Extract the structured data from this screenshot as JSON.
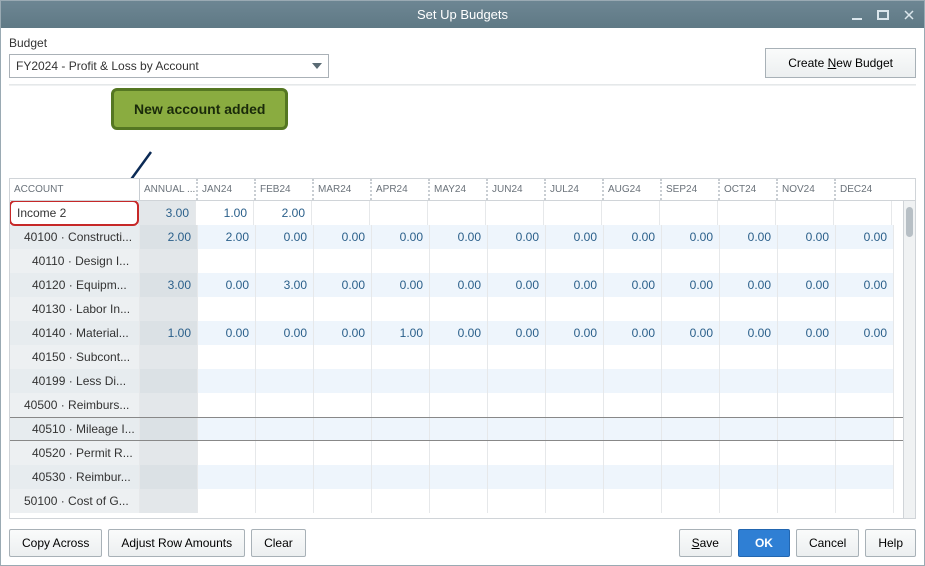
{
  "window": {
    "title": "Set Up Budgets"
  },
  "header": {
    "budget_label": "Budget",
    "dropdown_value": "FY2024 - Profit & Loss by Account",
    "create_button": "Create New Budget"
  },
  "annotation": {
    "label": "New account added"
  },
  "columns": {
    "account": "ACCOUNT",
    "annual": "ANNUAL ...",
    "months": [
      "JAN24",
      "FEB24",
      "MAR24",
      "APR24",
      "MAY24",
      "JUN24",
      "JUL24",
      "AUG24",
      "SEP24",
      "OCT24",
      "NOV24",
      "DEC24"
    ]
  },
  "rows": [
    {
      "account": "Income 2",
      "annual": "3.00",
      "months": [
        "1.00",
        "2.00",
        "",
        "",
        "",
        "",
        "",
        "",
        "",
        "",
        "",
        ""
      ],
      "hl": true
    },
    {
      "account": "40100 · Constructi...",
      "annual": "2.00",
      "months": [
        "2.00",
        "0.00",
        "0.00",
        "0.00",
        "0.00",
        "0.00",
        "0.00",
        "0.00",
        "0.00",
        "0.00",
        "0.00",
        "0.00"
      ],
      "indent": 1
    },
    {
      "account": "40110 · Design I...",
      "annual": "",
      "months": [
        "",
        "",
        "",
        "",
        "",
        "",
        "",
        "",
        "",
        "",
        "",
        ""
      ],
      "indent": 2
    },
    {
      "account": "40120 · Equipm...",
      "annual": "3.00",
      "months": [
        "0.00",
        "3.00",
        "0.00",
        "0.00",
        "0.00",
        "0.00",
        "0.00",
        "0.00",
        "0.00",
        "0.00",
        "0.00",
        "0.00"
      ],
      "indent": 2
    },
    {
      "account": "40130 · Labor In...",
      "annual": "",
      "months": [
        "",
        "",
        "",
        "",
        "",
        "",
        "",
        "",
        "",
        "",
        "",
        ""
      ],
      "indent": 2
    },
    {
      "account": "40140 · Material...",
      "annual": "1.00",
      "months": [
        "0.00",
        "0.00",
        "0.00",
        "1.00",
        "0.00",
        "0.00",
        "0.00",
        "0.00",
        "0.00",
        "0.00",
        "0.00",
        "0.00"
      ],
      "indent": 2
    },
    {
      "account": "40150 · Subcont...",
      "annual": "",
      "months": [
        "",
        "",
        "",
        "",
        "",
        "",
        "",
        "",
        "",
        "",
        "",
        ""
      ],
      "indent": 2
    },
    {
      "account": "40199 · Less Di...",
      "annual": "",
      "months": [
        "",
        "",
        "",
        "",
        "",
        "",
        "",
        "",
        "",
        "",
        "",
        ""
      ],
      "indent": 2
    },
    {
      "account": "40500 · Reimburs...",
      "annual": "",
      "months": [
        "",
        "",
        "",
        "",
        "",
        "",
        "",
        "",
        "",
        "",
        "",
        ""
      ],
      "indent": 1
    },
    {
      "account": "40510 · Mileage I...",
      "annual": "",
      "months": [
        "",
        "",
        "",
        "",
        "",
        "",
        "",
        "",
        "",
        "",
        "",
        ""
      ],
      "indent": 2,
      "active": true
    },
    {
      "account": "40520 · Permit R...",
      "annual": "",
      "months": [
        "",
        "",
        "",
        "",
        "",
        "",
        "",
        "",
        "",
        "",
        "",
        ""
      ],
      "indent": 2
    },
    {
      "account": "40530 · Reimbur...",
      "annual": "",
      "months": [
        "",
        "",
        "",
        "",
        "",
        "",
        "",
        "",
        "",
        "",
        "",
        ""
      ],
      "indent": 2
    },
    {
      "account": "50100 · Cost of G...",
      "annual": "",
      "months": [
        "",
        "",
        "",
        "",
        "",
        "",
        "",
        "",
        "",
        "",
        "",
        ""
      ],
      "indent": 1
    }
  ],
  "footer": {
    "copy_across": "Copy Across",
    "adjust_rows": "Adjust Row Amounts",
    "clear": "Clear",
    "save": "Save",
    "ok": "OK",
    "cancel": "Cancel",
    "help": "Help"
  }
}
